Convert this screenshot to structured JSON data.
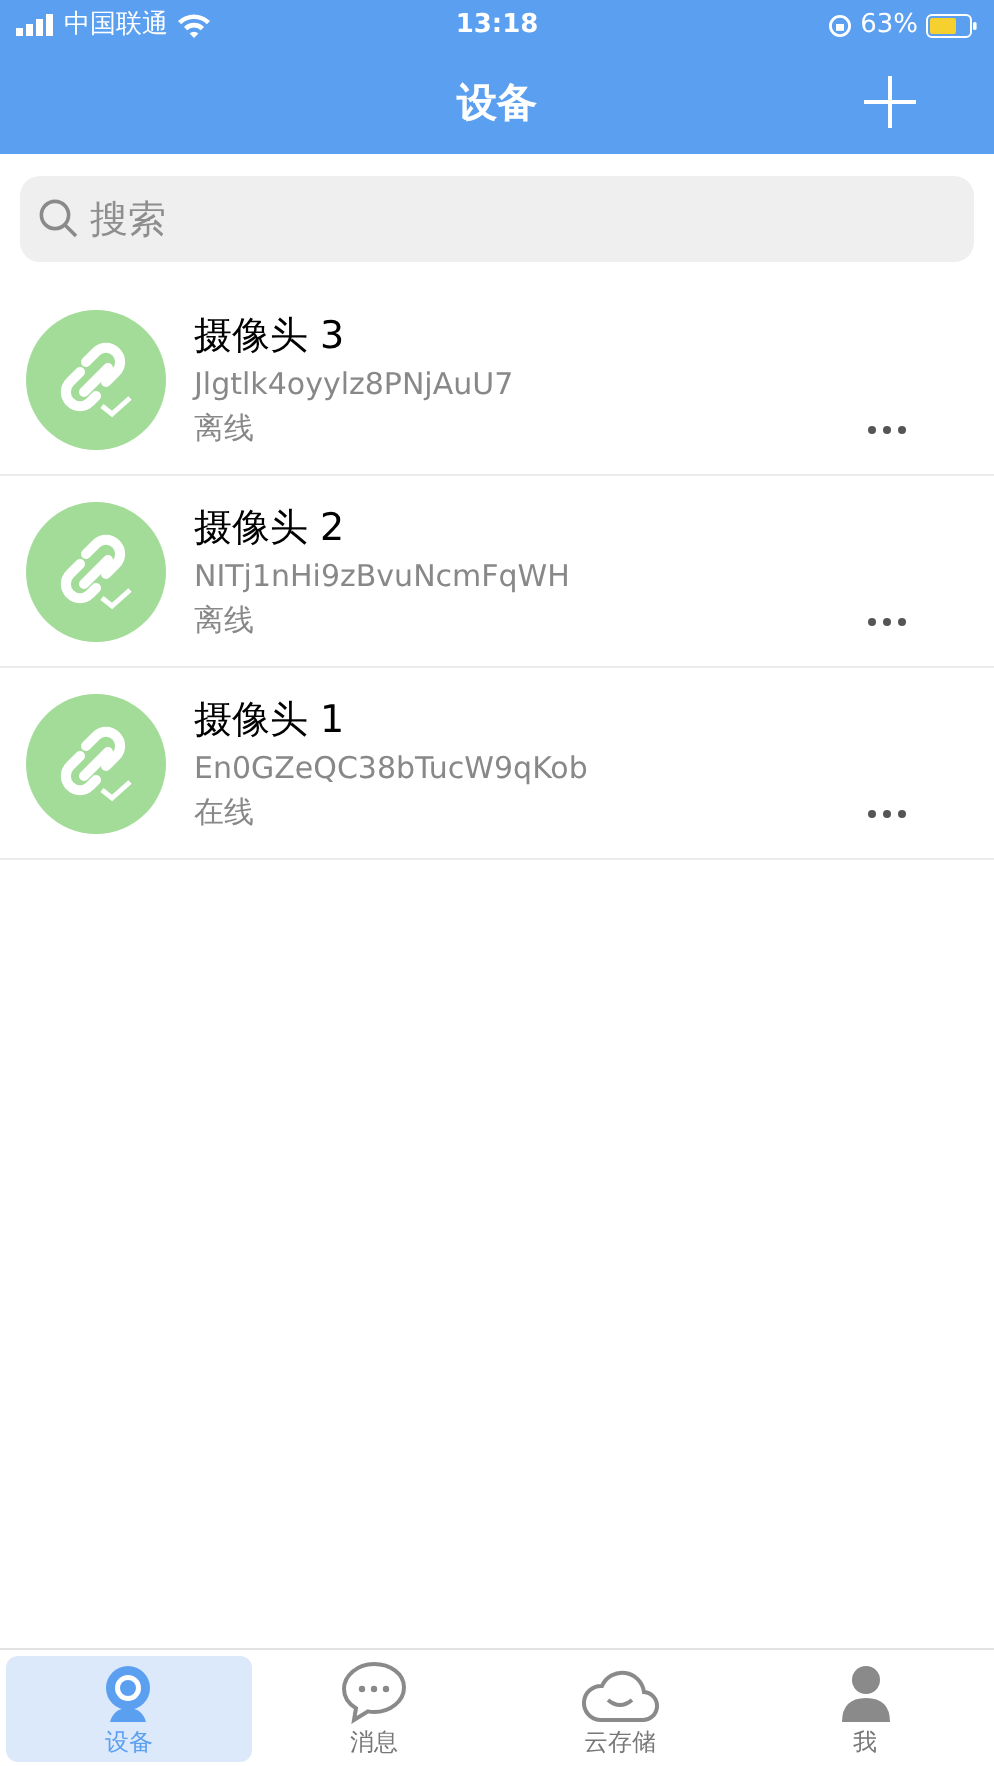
{
  "status_bar": {
    "carrier": "中国联通",
    "time": "13:18",
    "battery": "63%"
  },
  "header": {
    "title": "设备"
  },
  "search": {
    "placeholder": "搜索"
  },
  "devices": [
    {
      "name": "摄像头 3",
      "serial": "Jlgtlk4oyylz8PNjAuU7",
      "status": "离线"
    },
    {
      "name": "摄像头 2",
      "serial": "NITj1nHi9zBvuNcmFqWH",
      "status": "离线"
    },
    {
      "name": "摄像头 1",
      "serial": "En0GZeQC38bTucW9qKob",
      "status": "在线"
    }
  ],
  "tabs": [
    {
      "label": "设备",
      "kind": "camera",
      "selected": true
    },
    {
      "label": "消息",
      "kind": "chat",
      "selected": false
    },
    {
      "label": "云存储",
      "kind": "cloud",
      "selected": false
    },
    {
      "label": "我",
      "kind": "person",
      "selected": false
    }
  ]
}
